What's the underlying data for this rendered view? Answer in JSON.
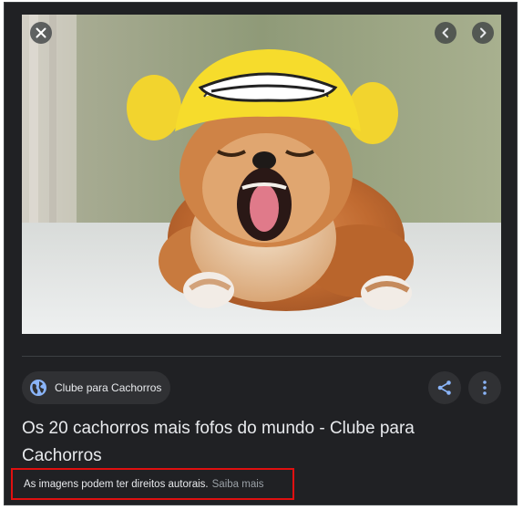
{
  "viewer": {
    "close_icon": "close-icon",
    "prev_icon": "chevron-left-icon",
    "next_icon": "chevron-right-icon",
    "image_subject": "pomeranian-dog-yawning-in-yellow-hat"
  },
  "source": {
    "label": "Clube para Cachorros",
    "icon": "globe-icon"
  },
  "actions": {
    "share_icon": "share-icon",
    "more_icon": "more-vertical-icon"
  },
  "result": {
    "title": "Os 20 cachorros mais fofos do mundo - Clube para Cachorros"
  },
  "notice": {
    "text": "As imagens podem ter direitos autorais.",
    "link": "Saiba mais"
  },
  "colors": {
    "panel_bg": "#202124",
    "chip_bg": "#303134",
    "text_primary": "#e8eaed",
    "text_secondary": "#9aa0a6",
    "globe_blue": "#8ab4f8",
    "highlight_border": "#e01010"
  }
}
